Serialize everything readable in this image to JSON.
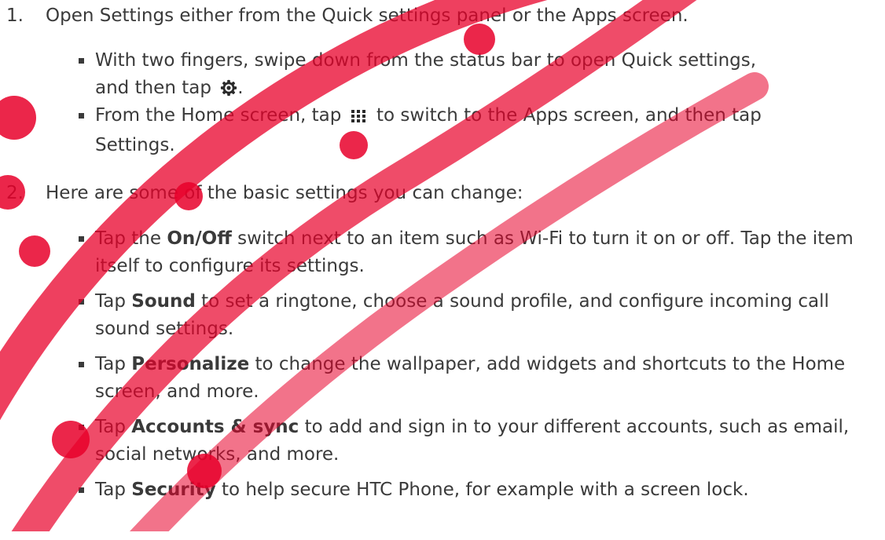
{
  "steps": [
    {
      "number": "1.",
      "text": "Open Settings either from the Quick settings panel or the Apps screen.",
      "bullets": [
        {
          "line1_before": "With two fingers, swipe down from the status bar to open Quick settings,",
          "line2_before": "and then tap",
          "line2_after": ".",
          "icon": "gear-icon"
        },
        {
          "line1_before": "From the Home screen, tap",
          "line1_after": "to switch to the Apps screen, and then tap",
          "line2_bold": "Settings",
          "line2_after": ".",
          "icon": "apps-grid-icon"
        }
      ]
    },
    {
      "number": "2.",
      "text": "Here are some of the basic settings you can change:",
      "bullets": [
        {
          "prefix": "Tap the",
          "bold": "On/Off",
          "rest": "switch next to an item such as Wi-Fi to turn it on or off. Tap the item itself to configure its settings."
        },
        {
          "prefix": "Tap",
          "bold": "Sound",
          "rest": "to set a ringtone, choose a sound profile, and configure incoming call sound settings."
        },
        {
          "prefix": "Tap",
          "bold": "Personalize",
          "rest": "to change the wallpaper, add widgets and shortcuts to the Home screen, and more."
        },
        {
          "prefix": "Tap",
          "bold": "Accounts & sync",
          "rest": "to add and sign in to your different accounts, such as email, social networks, and more."
        },
        {
          "prefix": "Tap",
          "bold": "Security",
          "rest": "to help secure HTC Phone, for example with a screen lock."
        }
      ]
    }
  ],
  "colors": {
    "text": "#3a3a3a",
    "watermark": "#e8002a"
  }
}
